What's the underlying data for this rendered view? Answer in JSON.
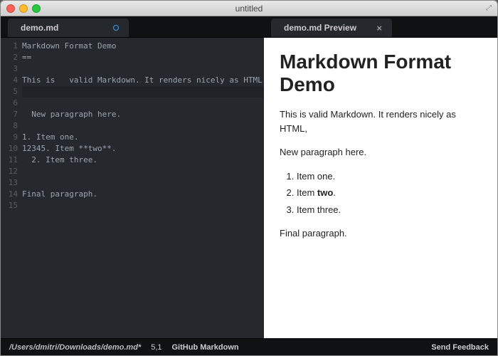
{
  "window": {
    "title": "untitled"
  },
  "tabs": {
    "left": {
      "label": "demo.md",
      "modified": true
    },
    "right": {
      "label": "demo.md Preview",
      "close": "×"
    }
  },
  "editor": {
    "lines": [
      "Markdown Format Demo",
      "==",
      "",
      "This is   valid Markdown. It renders nicely as HTML,",
      "",
      "",
      "  New paragraph here.",
      "",
      "1. Item one.",
      "12345. Item **two**.",
      "  2. Item three.",
      "",
      "",
      "Final paragraph.",
      ""
    ],
    "highlighted_line_index": 4
  },
  "preview": {
    "heading": "Markdown Format Demo",
    "p1": "This is valid Markdown. It renders nicely as HTML,",
    "p2": "New paragraph here.",
    "list": [
      "Item one.",
      [
        "Item ",
        "two",
        "."
      ],
      "Item three."
    ],
    "p3": "Final paragraph."
  },
  "status": {
    "path": "/Users/dmitri/Downloads/demo.md*",
    "cursor": "5,1",
    "mode": "GitHub Markdown",
    "feedback": "Send Feedback"
  }
}
